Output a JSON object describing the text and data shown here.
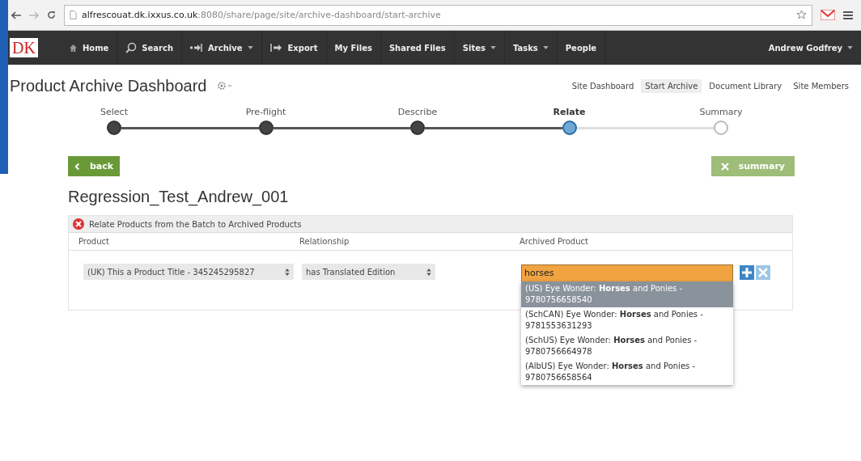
{
  "browser": {
    "url_host": "alfrescouat.dk.ixxus.co.uk",
    "url_rest": ":8080/share/page/site/archive-dashboard/start-archive"
  },
  "logo": "DK",
  "nav": [
    {
      "label": "Home",
      "kind": "house",
      "caret": false
    },
    {
      "label": "Search",
      "kind": "search",
      "caret": false
    },
    {
      "label": "Archive",
      "kind": "arrow",
      "caret": true
    },
    {
      "label": "Export",
      "kind": "export",
      "caret": false
    },
    {
      "label": "My Files",
      "kind": "plain",
      "caret": false
    },
    {
      "label": "Shared Files",
      "kind": "plain",
      "caret": false
    },
    {
      "label": "Sites",
      "kind": "plain",
      "caret": true
    },
    {
      "label": "Tasks",
      "kind": "plain",
      "caret": true
    },
    {
      "label": "People",
      "kind": "plain",
      "caret": false
    }
  ],
  "user": "Andrew Godfrey",
  "page_title": "Product Archive Dashboard",
  "site_links": [
    {
      "label": "Site Dashboard",
      "selected": false
    },
    {
      "label": "Start Archive",
      "selected": true
    },
    {
      "label": "Document Library",
      "selected": false
    },
    {
      "label": "Site Members",
      "selected": false
    }
  ],
  "steps": [
    {
      "label": "Select",
      "kind": "done"
    },
    {
      "label": "Pre-flight",
      "kind": "done"
    },
    {
      "label": "Describe",
      "kind": "done"
    },
    {
      "label": "Relate",
      "kind": "current"
    },
    {
      "label": "Summary",
      "kind": "todo"
    }
  ],
  "back_button": {
    "label": "back",
    "disabled": false
  },
  "summary_button": {
    "label": "summary",
    "disabled": true
  },
  "batch_title": "Regression_Test_Andrew_001",
  "panel": {
    "message": "Relate Products from the Batch to Archived Products",
    "columns": [
      "Product",
      "Relationship",
      "Archived Product"
    ],
    "product": "(UK) This a Product Title - 345245295827",
    "relationship": "has Translated Edition",
    "archived_value": "horses",
    "suggestions": [
      {
        "label": "(US) Eye Wonder: **Horses** and Ponies - 9780756658540",
        "selected": true
      },
      {
        "label": "(SchCAN) Eye Wonder: **Horses** and Ponies - 9781553631293",
        "selected": false
      },
      {
        "label": "(SchUS) Eye Wonder: **Horses** and Ponies - 9780756664978",
        "selected": false
      },
      {
        "label": "(AlbUS) Eye Wonder: **Horses** and Ponies - 9780756658564",
        "selected": false
      }
    ]
  }
}
